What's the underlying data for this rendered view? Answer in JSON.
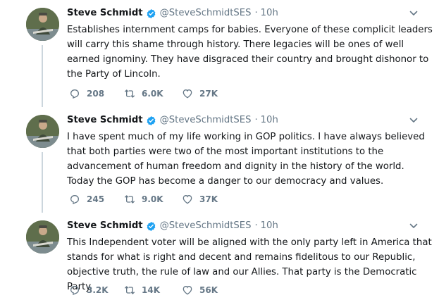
{
  "tweets": [
    {
      "author": "Steve Schmidt",
      "handle": "@SteveSchmidtSES",
      "separator": "·",
      "time": "10h",
      "text": "Establishes internment camps for babies. Everyone of these  complicit leaders will carry this shame through history. There legacies will be ones of well earned ignominy. They have disgraced their country and brought dishonor to the Party of Lincoln.",
      "replies": "208",
      "retweets": "6.0K",
      "likes": "27K"
    },
    {
      "author": "Steve Schmidt",
      "handle": "@SteveSchmidtSES",
      "separator": "·",
      "time": "10h",
      "text": "I have spent much of my life working in GOP politics. I have always believed that both parties were two of the most important institutions to the advancement of human freedom and dignity in the history of the world. Today the GOP has become a danger to our democracy and values.",
      "replies": "245",
      "retweets": "9.0K",
      "likes": "37K"
    },
    {
      "author": "Steve Schmidt",
      "handle": "@SteveSchmidtSES",
      "separator": "·",
      "time": "10h",
      "text": "This Independent voter will be aligned with the only party left in America that stands for what is right and decent and remains fidelitous to our Republic, objective truth, the rule of law and our Allies. That party is the Democratic Party.",
      "replies": "3.2K",
      "retweets": "14K",
      "likes": "56K"
    }
  ],
  "icons": {
    "verified": "verified-badge-icon",
    "caret": "chevron-down-icon",
    "reply": "reply-icon",
    "retweet": "retweet-icon",
    "like": "heart-icon"
  },
  "colors": {
    "verified": "#1da1f2",
    "secondary_text": "#657786",
    "thread_line": "#ccd6dd"
  }
}
